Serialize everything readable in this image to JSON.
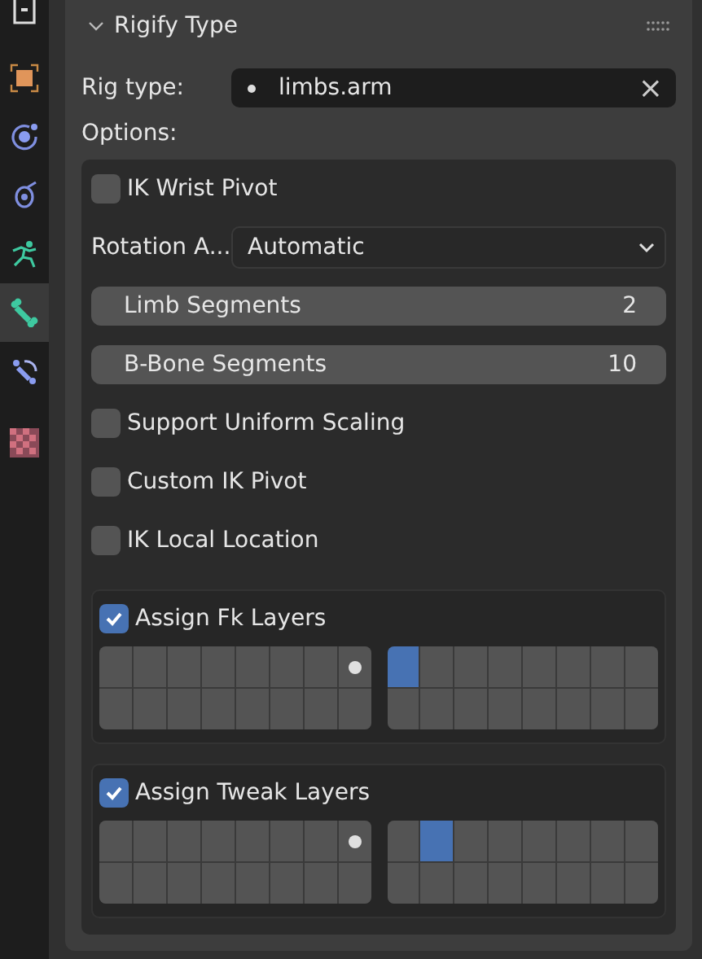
{
  "tabs": [
    {
      "kind": "partial",
      "selected": false
    },
    {
      "kind": "object",
      "selected": false
    },
    {
      "kind": "modifier",
      "selected": false
    },
    {
      "kind": "physics",
      "selected": false
    },
    {
      "kind": "pose",
      "selected": false
    },
    {
      "kind": "bone",
      "selected": true
    },
    {
      "kind": "constraint",
      "selected": false
    },
    {
      "kind": "texture",
      "selected": false
    }
  ],
  "panel": {
    "title": "Rigify Type",
    "expanded": true
  },
  "rig_type": {
    "label": "Rig type:",
    "value": "limbs.arm",
    "clear": "×"
  },
  "options_label": "Options:",
  "options": [
    {
      "kind": "checkbox",
      "label": "IK Wrist Pivot",
      "checked": false
    },
    {
      "kind": "dropdown",
      "label": "Rotation A...",
      "value": "Automatic"
    },
    {
      "kind": "number",
      "label": "Limb Segments",
      "value": "2"
    },
    {
      "kind": "number",
      "label": "B-Bone Segments",
      "value": "10"
    },
    {
      "kind": "checkbox",
      "label": "Support Uniform Scaling",
      "checked": false
    },
    {
      "kind": "checkbox",
      "label": "Custom IK Pivot",
      "checked": false
    },
    {
      "kind": "checkbox",
      "label": "IK Local Location",
      "checked": false
    }
  ],
  "layer_groups": [
    {
      "label": "Assign Fk Layers",
      "checked": true,
      "blocks": [
        {
          "cells": [
            {
              "selected": false,
              "used": false
            },
            {
              "selected": false,
              "used": false
            },
            {
              "selected": false,
              "used": false
            },
            {
              "selected": false,
              "used": false
            },
            {
              "selected": false,
              "used": false
            },
            {
              "selected": false,
              "used": false
            },
            {
              "selected": false,
              "used": false
            },
            {
              "selected": false,
              "used": true
            },
            {
              "selected": false,
              "used": false
            },
            {
              "selected": false,
              "used": false
            },
            {
              "selected": false,
              "used": false
            },
            {
              "selected": false,
              "used": false
            },
            {
              "selected": false,
              "used": false
            },
            {
              "selected": false,
              "used": false
            },
            {
              "selected": false,
              "used": false
            },
            {
              "selected": false,
              "used": false
            }
          ]
        },
        {
          "cells": [
            {
              "selected": true,
              "used": false
            },
            {
              "selected": false,
              "used": false
            },
            {
              "selected": false,
              "used": false
            },
            {
              "selected": false,
              "used": false
            },
            {
              "selected": false,
              "used": false
            },
            {
              "selected": false,
              "used": false
            },
            {
              "selected": false,
              "used": false
            },
            {
              "selected": false,
              "used": false
            },
            {
              "selected": false,
              "used": false
            },
            {
              "selected": false,
              "used": false
            },
            {
              "selected": false,
              "used": false
            },
            {
              "selected": false,
              "used": false
            },
            {
              "selected": false,
              "used": false
            },
            {
              "selected": false,
              "used": false
            },
            {
              "selected": false,
              "used": false
            },
            {
              "selected": false,
              "used": false
            }
          ]
        }
      ]
    },
    {
      "label": "Assign Tweak Layers",
      "checked": true,
      "blocks": [
        {
          "cells": [
            {
              "selected": false,
              "used": false
            },
            {
              "selected": false,
              "used": false
            },
            {
              "selected": false,
              "used": false
            },
            {
              "selected": false,
              "used": false
            },
            {
              "selected": false,
              "used": false
            },
            {
              "selected": false,
              "used": false
            },
            {
              "selected": false,
              "used": false
            },
            {
              "selected": false,
              "used": true
            },
            {
              "selected": false,
              "used": false
            },
            {
              "selected": false,
              "used": false
            },
            {
              "selected": false,
              "used": false
            },
            {
              "selected": false,
              "used": false
            },
            {
              "selected": false,
              "used": false
            },
            {
              "selected": false,
              "used": false
            },
            {
              "selected": false,
              "used": false
            },
            {
              "selected": false,
              "used": false
            }
          ]
        },
        {
          "cells": [
            {
              "selected": false,
              "used": false
            },
            {
              "selected": true,
              "used": false
            },
            {
              "selected": false,
              "used": false
            },
            {
              "selected": false,
              "used": false
            },
            {
              "selected": false,
              "used": false
            },
            {
              "selected": false,
              "used": false
            },
            {
              "selected": false,
              "used": false
            },
            {
              "selected": false,
              "used": false
            },
            {
              "selected": false,
              "used": false
            },
            {
              "selected": false,
              "used": false
            },
            {
              "selected": false,
              "used": false
            },
            {
              "selected": false,
              "used": false
            },
            {
              "selected": false,
              "used": false
            },
            {
              "selected": false,
              "used": false
            },
            {
              "selected": false,
              "used": false
            },
            {
              "selected": false,
              "used": false
            }
          ]
        }
      ]
    }
  ]
}
